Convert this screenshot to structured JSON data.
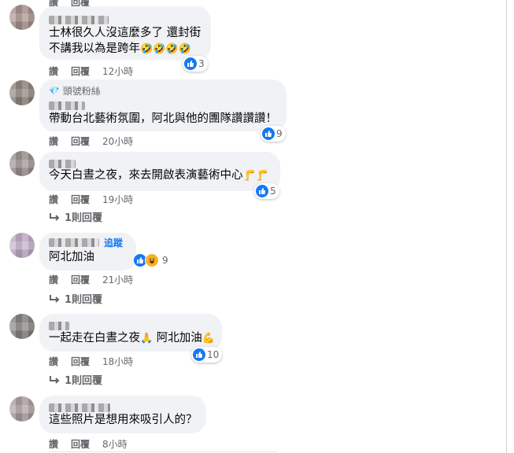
{
  "labels": {
    "like": "讚",
    "reply": "回覆"
  },
  "comments": [
    {
      "text1": "士林很久人沒這麼多了 還封街",
      "text2": "不講我以為是跨年",
      "emoji": "🤣🤣🤣🤣",
      "reactions": "3",
      "time": "12小時"
    },
    {
      "badge": "頭號粉絲",
      "text1": "帶動台北藝術氛圍，阿北與他的團隊讚讚讚！",
      "reactions": "9",
      "time": "20小時"
    },
    {
      "text1": "今天白晝之夜，來去開啟表演藝術中心",
      "emoji": "🦵🦵",
      "reactions": "5",
      "time": "19小時",
      "replies": "1則回覆"
    },
    {
      "follow": "追蹤",
      "text1": "阿北加油",
      "reactions": "9",
      "time": "21小時",
      "replies": "1則回覆"
    },
    {
      "text1": "一起走在白晝之夜",
      "emoji1": "🙏",
      "text2": "阿北加油",
      "emoji2": "💪",
      "reactions": "10",
      "time": "18小時",
      "replies": "1則回覆"
    },
    {
      "text1": "這些照片是想用來吸引人的？",
      "time": "8小時"
    }
  ]
}
